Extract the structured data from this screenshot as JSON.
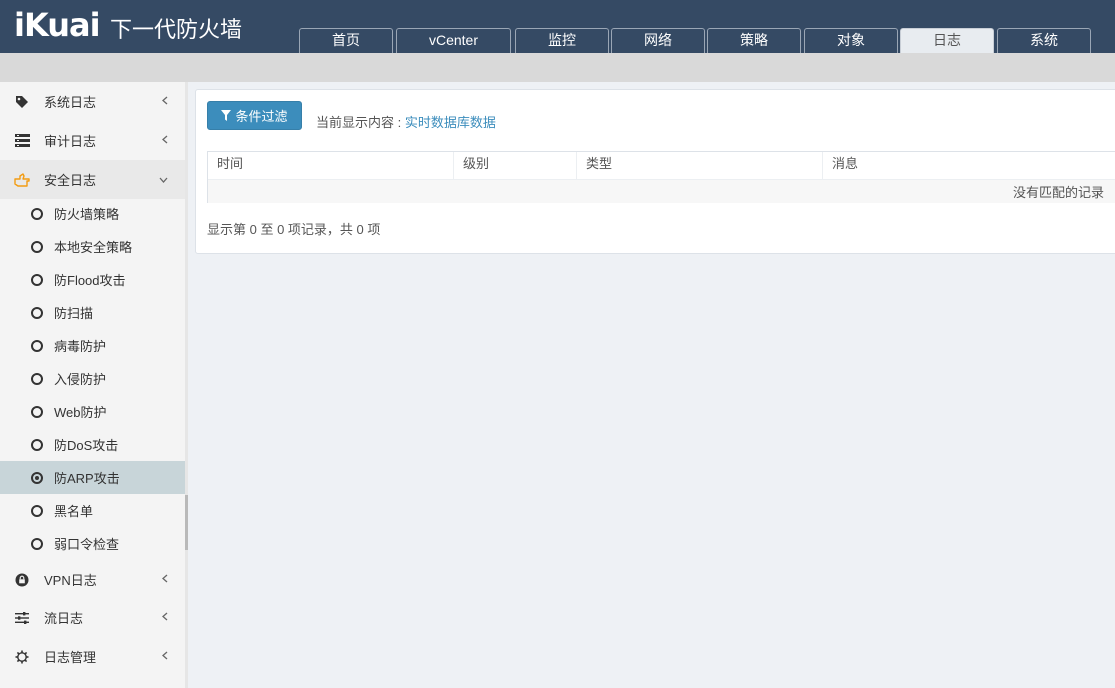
{
  "header": {
    "logo": "iKuai",
    "product": "下一代防火墙",
    "tabs": [
      {
        "label": "首页"
      },
      {
        "label": "vCenter"
      },
      {
        "label": "监控"
      },
      {
        "label": "网络"
      },
      {
        "label": "策略"
      },
      {
        "label": "对象"
      },
      {
        "label": "日志",
        "active": true
      },
      {
        "label": "系统"
      }
    ]
  },
  "sidebar": {
    "groups": [
      {
        "label": "系统日志",
        "icon": "tag-icon"
      },
      {
        "label": "审计日志",
        "icon": "list-icon"
      },
      {
        "label": "安全日志",
        "icon": "hand-point-icon",
        "open": true
      },
      {
        "label": "VPN日志",
        "icon": "lock-circle-icon"
      },
      {
        "label": "流日志",
        "icon": "sliders-icon"
      },
      {
        "label": "日志管理",
        "icon": "gear-icon"
      }
    ],
    "security_items": [
      {
        "label": "防火墙策略"
      },
      {
        "label": "本地安全策略"
      },
      {
        "label": "防Flood攻击"
      },
      {
        "label": "防扫描"
      },
      {
        "label": "病毒防护"
      },
      {
        "label": "入侵防护"
      },
      {
        "label": "Web防护"
      },
      {
        "label": "防DoS攻击"
      },
      {
        "label": "防ARP攻击",
        "selected": true
      },
      {
        "label": "黑名单"
      },
      {
        "label": "弱口令检查"
      }
    ]
  },
  "main": {
    "filter_button": "条件过滤",
    "current_label": "当前显示内容 : ",
    "current_value": "实时数据库数据",
    "columns": [
      "时间",
      "级别",
      "类型",
      "消息"
    ],
    "empty_message": "没有匹配的记录",
    "info": "显示第 0 至 0 项记录，共 0 项"
  },
  "colors": {
    "header_bg": "#354a64",
    "accent": "#3c8dbc",
    "selected_item": "#c8d5d9",
    "security_icon": "#f39c12"
  }
}
